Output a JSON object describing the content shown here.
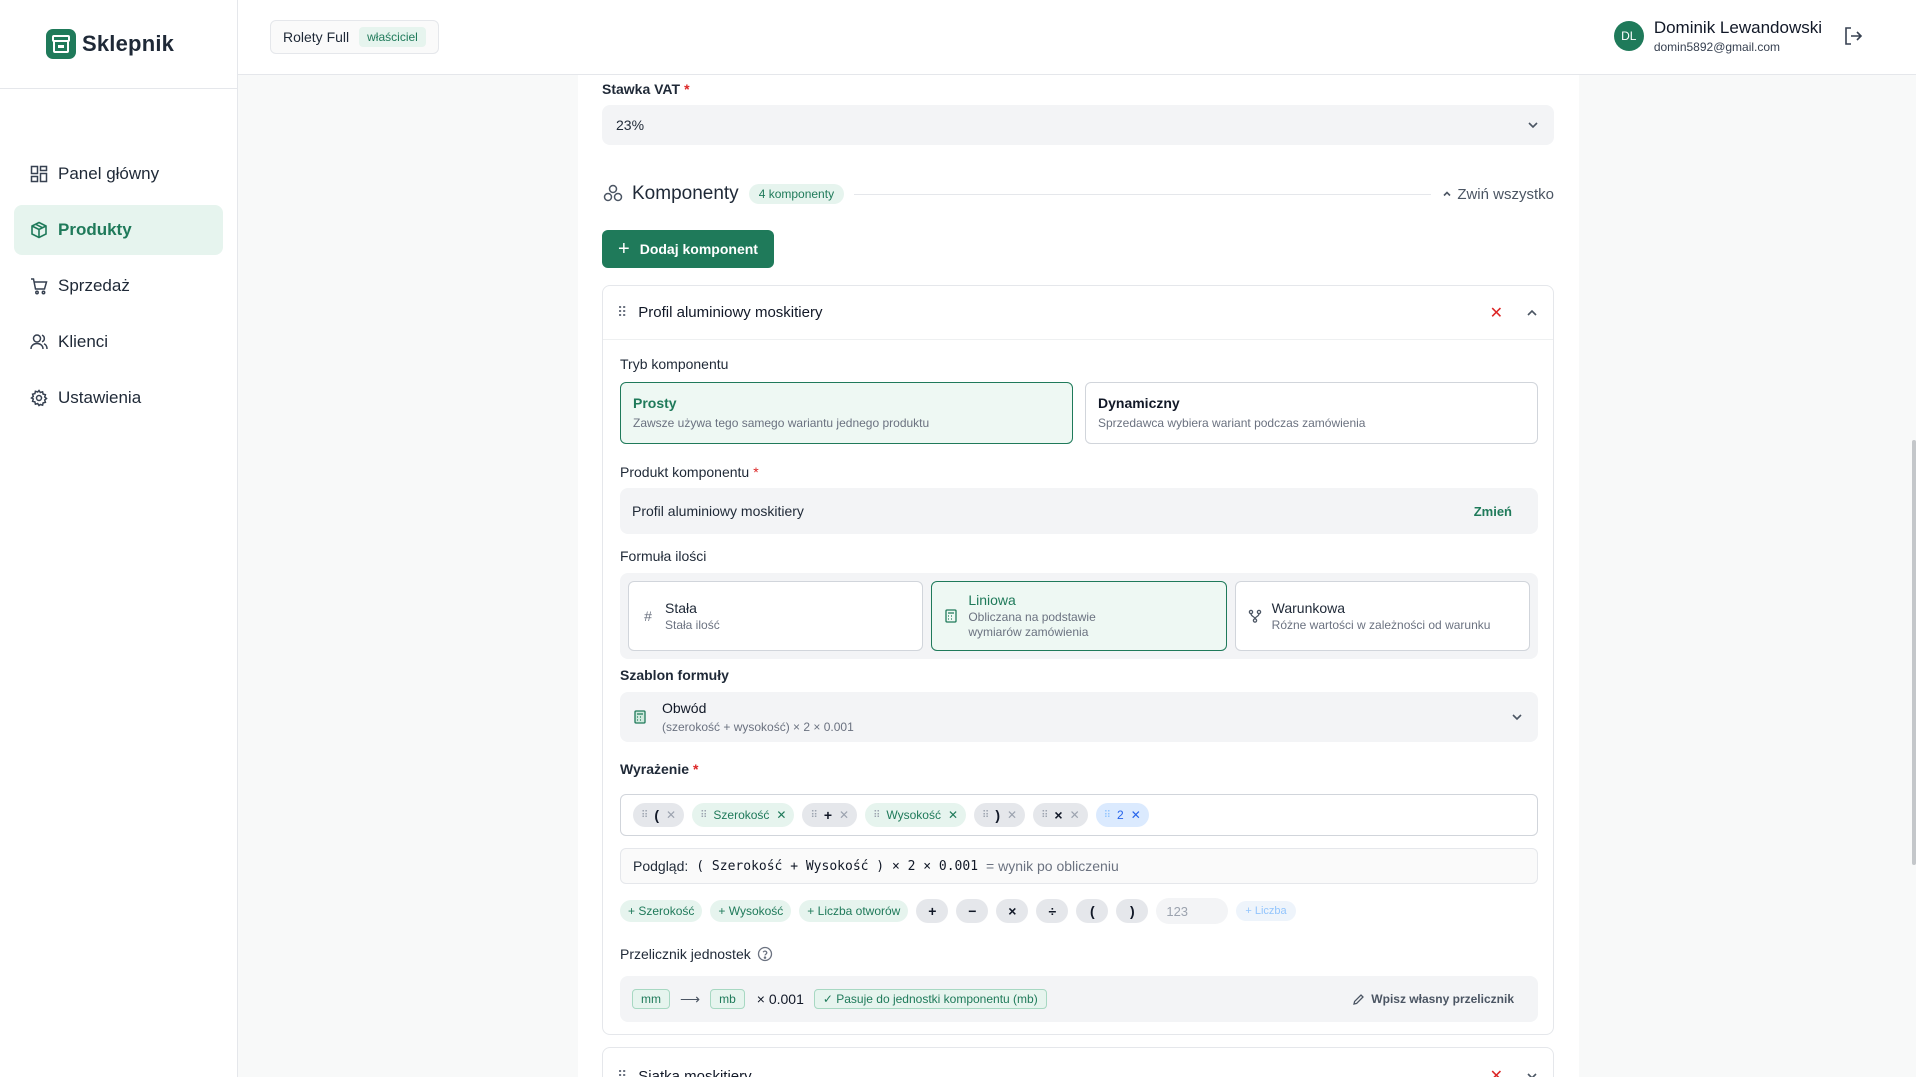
{
  "app": {
    "name": "Sklepnik"
  },
  "sidebar": {
    "items": [
      {
        "label": "Panel główny",
        "icon": "dashboard-icon"
      },
      {
        "label": "Produkty",
        "icon": "box-icon",
        "active": true
      },
      {
        "label": "Sprzedaż",
        "icon": "cart-icon"
      },
      {
        "label": "Klienci",
        "icon": "users-icon"
      },
      {
        "label": "Ustawienia",
        "icon": "gear-icon"
      }
    ]
  },
  "topbar": {
    "store": "Rolety Full",
    "role": "właściciel",
    "user_initials": "DL",
    "user_name": "Dominik Lewandowski",
    "user_email": "domin5892@gmail.com"
  },
  "form": {
    "vat_label": "Stawka VAT",
    "vat_value": "23%",
    "components_title": "Komponenty",
    "components_count": "4 komponenty",
    "collapse_all": "Zwiń wszystko",
    "add_component": "Dodaj komponent"
  },
  "component1": {
    "title": "Profil aluminiowy moskitiery",
    "mode_label": "Tryb komponentu",
    "modes": [
      {
        "title": "Prosty",
        "desc": "Zawsze używa tego samego wariantu jednego produktu",
        "selected": true
      },
      {
        "title": "Dynamiczny",
        "desc": "Sprzedawca wybiera wariant podczas zamówienia",
        "selected": false
      }
    ],
    "product_label": "Produkt komponentu",
    "product_value": "Profil aluminiowy moskitiery",
    "change": "Zmień",
    "formula_label": "Formuła ilości",
    "formula_options": [
      {
        "title": "Stała",
        "desc": "Stała ilość",
        "icon": "hash-icon"
      },
      {
        "title": "Liniowa",
        "desc": "Obliczana na podstawie wymiarów zamówienia",
        "icon": "calculator-icon",
        "selected": true
      },
      {
        "title": "Warunkowa",
        "desc": "Różne wartości w zależności od warunku",
        "icon": "branch-icon"
      }
    ],
    "template_label": "Szablon formuły",
    "template_title": "Obwód",
    "template_desc": "(szerokość + wysokość) × 2 × 0.001",
    "expression_label": "Wyrażenie",
    "tokens": [
      {
        "text": "(",
        "kind": "op"
      },
      {
        "text": "Szerokość",
        "kind": "var"
      },
      {
        "text": "+",
        "kind": "op"
      },
      {
        "text": "Wysokość",
        "kind": "var"
      },
      {
        "text": ")",
        "kind": "op"
      },
      {
        "text": "×",
        "kind": "op"
      },
      {
        "text": "2",
        "kind": "num"
      }
    ],
    "preview_label": "Podgląd:",
    "preview_code": "( Szerokość + Wysokość ) × 2 × 0.001",
    "preview_result": "= wynik po obliczeniu",
    "quick_vars": [
      "+ Szerokość",
      "+ Wysokość",
      "+ Liczba otworów"
    ],
    "quick_ops": [
      "+",
      "−",
      "×",
      "÷",
      "(",
      ")"
    ],
    "number_placeholder": "123",
    "add_number": "+ Liczba",
    "converter_label": "Przelicznik jednostek",
    "unit_from": "mm",
    "unit_to": "mb",
    "factor": "× 0.001",
    "match": "Pasuje do jednostki komponentu (mb)",
    "custom": "Wpisz własny przelicznik"
  },
  "component2": {
    "title": "Siatka moskitiery"
  },
  "colors": {
    "accent": "#1f7a5a",
    "danger": "#dc2626",
    "accent_light": "#e6f4ee"
  }
}
